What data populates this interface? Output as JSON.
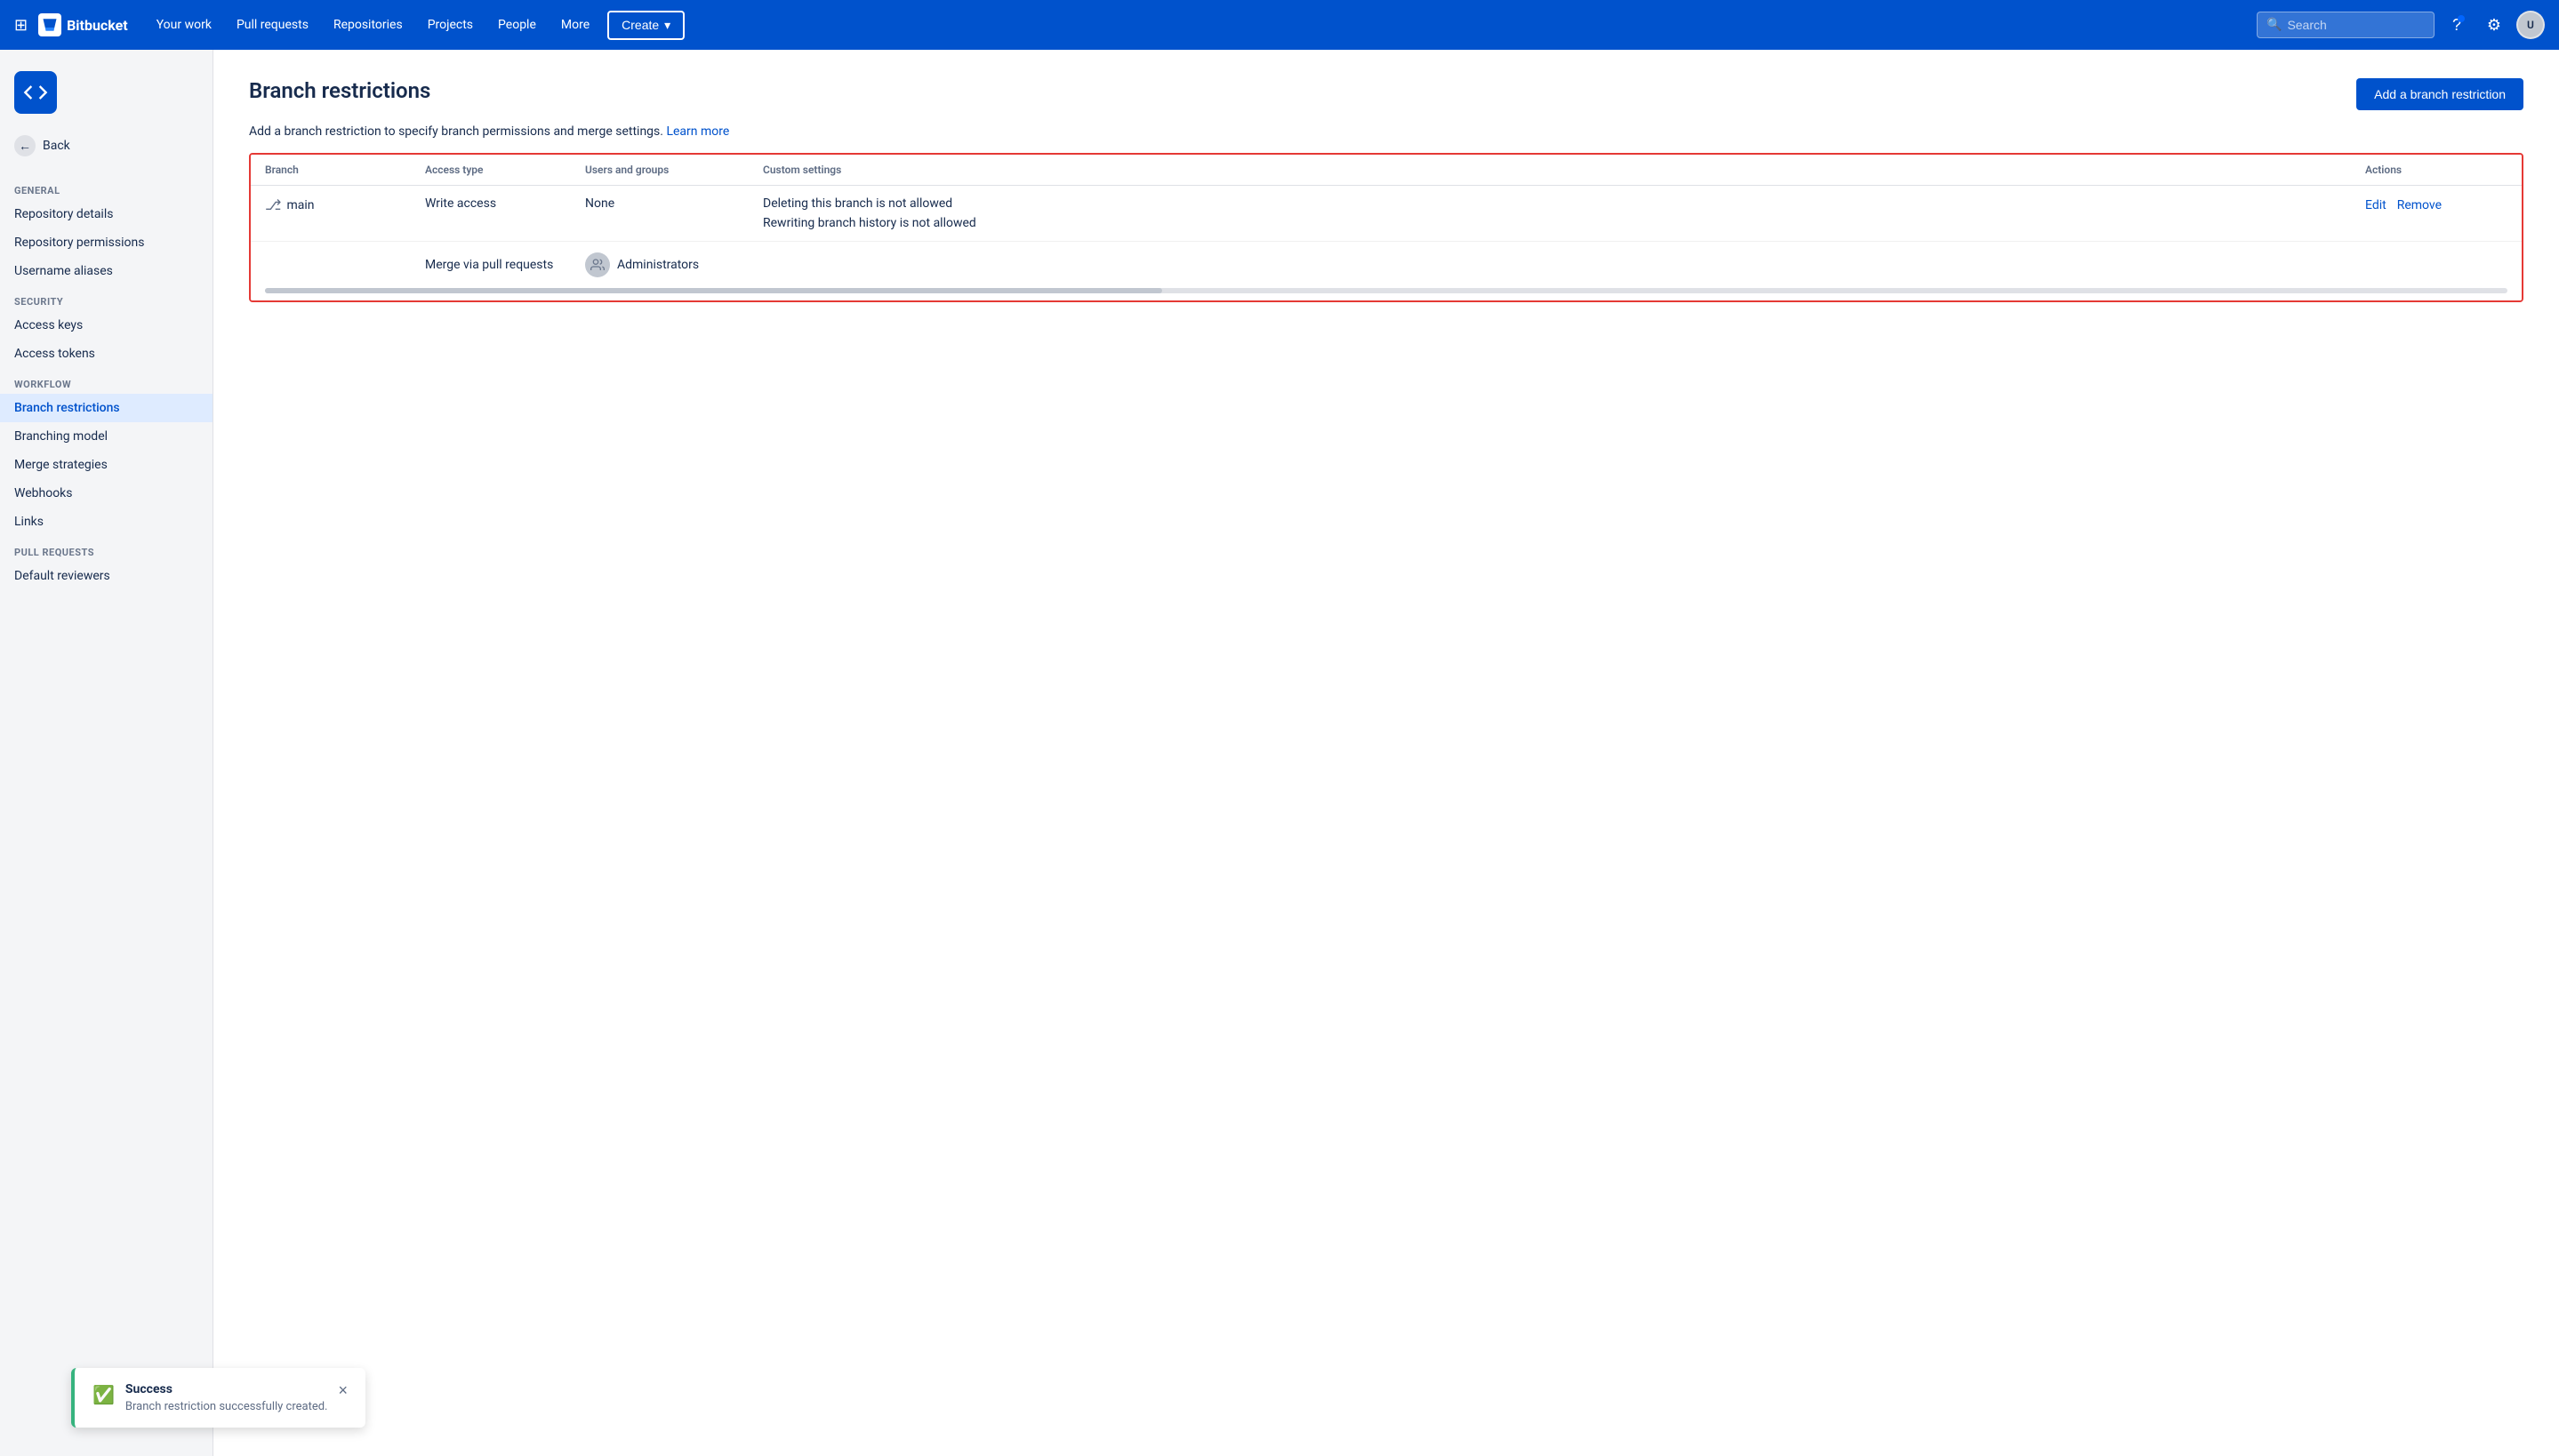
{
  "navbar": {
    "logo_text": "Bitbucket",
    "nav_items": [
      {
        "label": "Your work",
        "id": "your-work"
      },
      {
        "label": "Pull requests",
        "id": "pull-requests"
      },
      {
        "label": "Repositories",
        "id": "repositories"
      },
      {
        "label": "Projects",
        "id": "projects"
      },
      {
        "label": "People",
        "id": "people"
      },
      {
        "label": "More",
        "id": "more"
      }
    ],
    "create_label": "Create",
    "search_placeholder": "Search",
    "avatar_initials": "U"
  },
  "sidebar": {
    "back_label": "Back",
    "sections": [
      {
        "label": "GENERAL",
        "items": [
          {
            "label": "Repository details",
            "id": "repo-details",
            "active": false
          },
          {
            "label": "Repository permissions",
            "id": "repo-permissions",
            "active": false
          },
          {
            "label": "Username aliases",
            "id": "username-aliases",
            "active": false
          }
        ]
      },
      {
        "label": "SECURITY",
        "items": [
          {
            "label": "Access keys",
            "id": "access-keys",
            "active": false
          },
          {
            "label": "Access tokens",
            "id": "access-tokens",
            "active": false
          }
        ]
      },
      {
        "label": "WORKFLOW",
        "items": [
          {
            "label": "Branch restrictions",
            "id": "branch-restrictions",
            "active": true
          },
          {
            "label": "Branching model",
            "id": "branching-model",
            "active": false
          },
          {
            "label": "Merge strategies",
            "id": "merge-strategies",
            "active": false
          },
          {
            "label": "Webhooks",
            "id": "webhooks",
            "active": false
          },
          {
            "label": "Links",
            "id": "links",
            "active": false
          }
        ]
      },
      {
        "label": "PULL REQUESTS",
        "items": [
          {
            "label": "Default reviewers",
            "id": "default-reviewers",
            "active": false
          }
        ]
      }
    ]
  },
  "main": {
    "page_title": "Branch restrictions",
    "add_button_label": "Add a branch restriction",
    "description_text": "Add a branch restriction to specify branch permissions and merge settings.",
    "learn_more_label": "Learn more",
    "table": {
      "headers": [
        "Branch",
        "Access type",
        "Users and groups",
        "Custom settings",
        "Actions"
      ],
      "row": {
        "branch_name": "main",
        "access_type_write": "Write access",
        "users_groups_write": "None",
        "custom_settings": [
          "Deleting this branch is not allowed",
          "Rewriting branch history is not allowed"
        ],
        "access_type_merge": "Merge via pull requests",
        "users_groups_merge": "Administrators",
        "edit_label": "Edit",
        "remove_label": "Remove"
      }
    }
  },
  "toast": {
    "title": "Success",
    "message": "Branch restriction successfully created.",
    "close_label": "×"
  },
  "colors": {
    "primary": "#0052cc",
    "success": "#36b37e",
    "danger": "#e53935"
  }
}
